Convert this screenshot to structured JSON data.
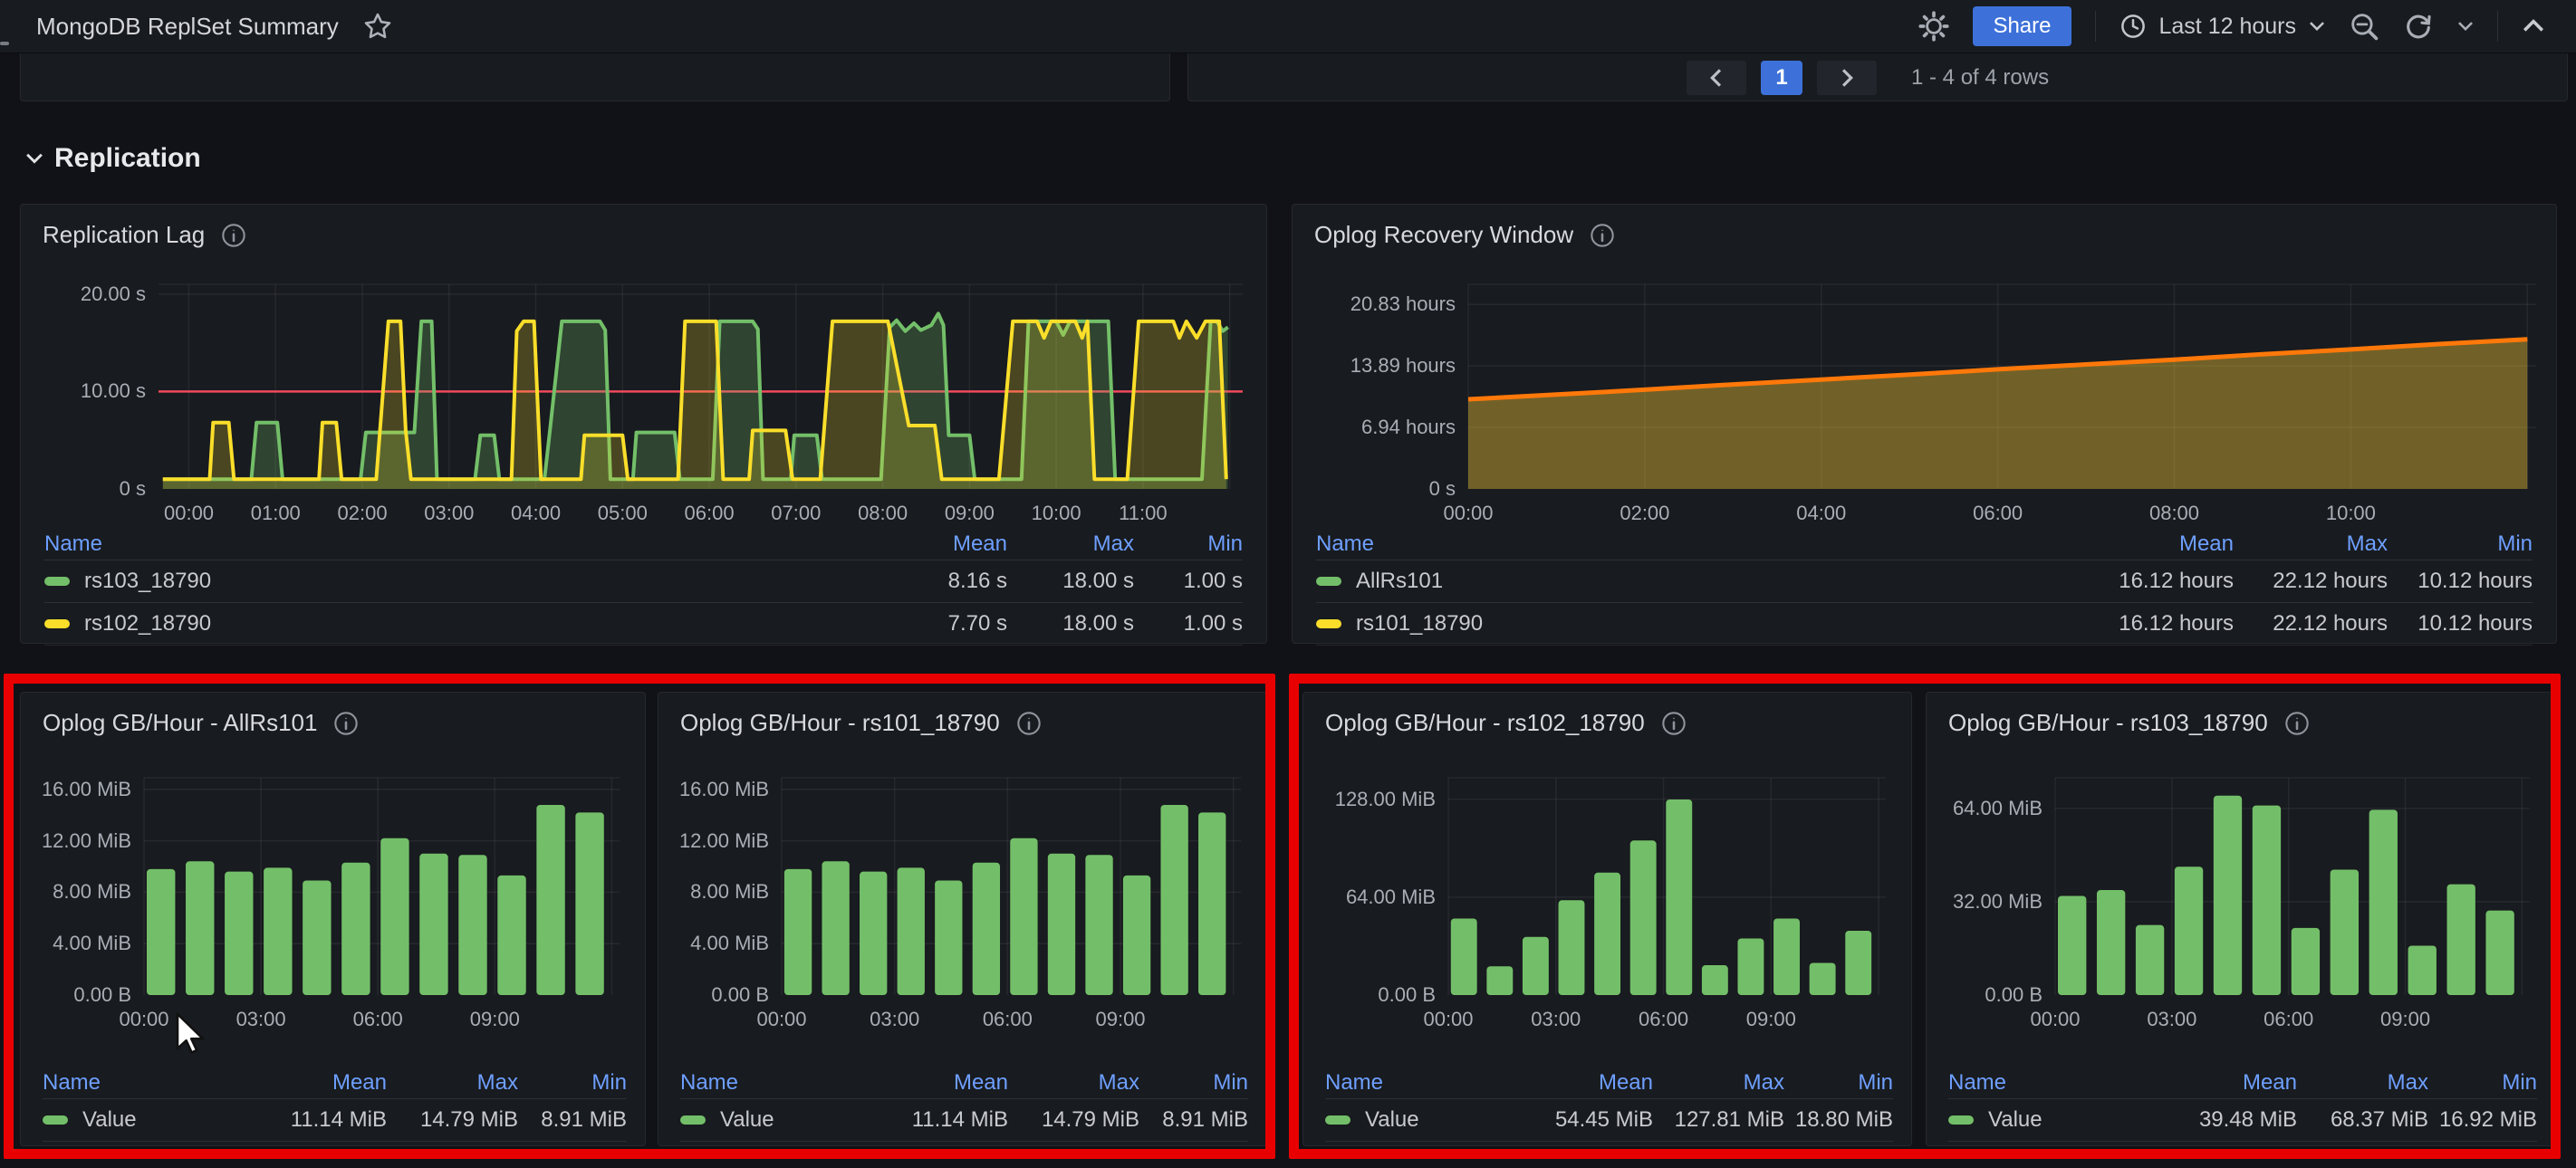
{
  "topbar": {
    "title": "MongoDB ReplSet Summary",
    "share_label": "Share",
    "time_range": "Last 12 hours"
  },
  "pagination": {
    "page": "1",
    "info": "1 - 4 of 4 rows"
  },
  "section": {
    "title": "Replication"
  },
  "colors": {
    "green": "#73BF69",
    "yellow": "#FADE2A",
    "orange": "#FF780A",
    "threshold_red": "#F2495C",
    "accent_blue": "#3D71D9",
    "legend_header_blue": "#6E9FFF",
    "annotation_red": "#E80000",
    "panel_bg": "#181b1f",
    "page_bg": "#111217"
  },
  "icons": {
    "star-icon": "outline star",
    "gear-icon": "settings gear",
    "clock-icon": "time range clock",
    "zoom-out-icon": "magnifier with minus",
    "refresh-icon": "circular arrow",
    "chevron-down-icon": "caret down",
    "chevron-up-icon": "collapse caret",
    "info-icon": "circled i"
  },
  "panels": {
    "replication_lag": {
      "title": "Replication Lag",
      "legend": {
        "headers": [
          "Name",
          "Mean",
          "Max",
          "Min"
        ],
        "rows": [
          {
            "name": "rs103_18790",
            "color": "#73BF69",
            "mean": "8.16 s",
            "max": "18.00 s",
            "min": "1.00 s"
          },
          {
            "name": "rs102_18790",
            "color": "#FADE2A",
            "mean": "7.70 s",
            "max": "18.00 s",
            "min": "1.00 s"
          }
        ]
      }
    },
    "oplog_recovery": {
      "title": "Oplog Recovery Window",
      "legend": {
        "headers": [
          "Name",
          "Mean",
          "Max",
          "Min"
        ],
        "rows": [
          {
            "name": "AllRs101",
            "color": "#73BF69",
            "mean": "16.12 hours",
            "max": "22.12 hours",
            "min": "10.12 hours"
          },
          {
            "name": "rs101_18790",
            "color": "#FADE2A",
            "mean": "16.12 hours",
            "max": "22.12 hours",
            "min": "10.12 hours"
          }
        ]
      }
    },
    "oplog": [
      {
        "title": "Oplog GB/Hour - AllRs101",
        "legend": {
          "headers": [
            "Name",
            "Mean",
            "Max",
            "Min"
          ],
          "row": {
            "name": "Value",
            "color": "#73BF69",
            "mean": "11.14 MiB",
            "max": "14.79 MiB",
            "min": "8.91 MiB"
          }
        }
      },
      {
        "title": "Oplog GB/Hour - rs101_18790",
        "legend": {
          "headers": [
            "Name",
            "Mean",
            "Max",
            "Min"
          ],
          "row": {
            "name": "Value",
            "color": "#73BF69",
            "mean": "11.14 MiB",
            "max": "14.79 MiB",
            "min": "8.91 MiB"
          }
        }
      },
      {
        "title": "Oplog GB/Hour - rs102_18790",
        "legend": {
          "headers": [
            "Name",
            "Mean",
            "Max",
            "Min"
          ],
          "row": {
            "name": "Value",
            "color": "#73BF69",
            "mean": "54.45 MiB",
            "max": "127.81 MiB",
            "min": "18.80 MiB"
          }
        }
      },
      {
        "title": "Oplog GB/Hour - rs103_18790",
        "legend": {
          "headers": [
            "Name",
            "Mean",
            "Max",
            "Min"
          ],
          "row": {
            "name": "Value",
            "color": "#73BF69",
            "mean": "39.48 MiB",
            "max": "68.37 MiB",
            "min": "16.92 MiB"
          }
        }
      }
    ]
  },
  "chart_data": [
    {
      "id": "replag",
      "type": "line",
      "title": "Replication Lag",
      "xlim": [
        -0.35,
        12.15
      ],
      "ylim": [
        0,
        21
      ],
      "pad": {
        "l": 130,
        "r": 18,
        "t": 8,
        "b": 56
      },
      "x_ticks": [
        {
          "v": 0,
          "label": "00:00"
        },
        {
          "v": 1,
          "label": "01:00"
        },
        {
          "v": 2,
          "label": "02:00"
        },
        {
          "v": 3,
          "label": "03:00"
        },
        {
          "v": 4,
          "label": "04:00"
        },
        {
          "v": 5,
          "label": "05:00"
        },
        {
          "v": 6,
          "label": "06:00"
        },
        {
          "v": 7,
          "label": "07:00"
        },
        {
          "v": 8,
          "label": "08:00"
        },
        {
          "v": 9,
          "label": "09:00"
        },
        {
          "v": 10,
          "label": "10:00"
        },
        {
          "v": 11,
          "label": "11:00"
        },
        {
          "v": 12,
          "label": ""
        }
      ],
      "y_ticks": [
        {
          "v": 0,
          "label": "0 s"
        },
        {
          "v": 10,
          "label": "10.00 s"
        },
        {
          "v": 20,
          "label": "20.00 s"
        }
      ],
      "threshold": {
        "v": 10,
        "color": "#F2495C"
      },
      "series": [
        {
          "name": "rs103_18790",
          "color": "#73BF69",
          "fill": "rgba(115,191,105,0.25)",
          "width": 4,
          "points": [
            [
              -0.3,
              1
            ],
            [
              0.72,
              1
            ],
            [
              0.78,
              6.8
            ],
            [
              1.02,
              6.8
            ],
            [
              1.08,
              1
            ],
            [
              1.98,
              1
            ],
            [
              2.04,
              5.8
            ],
            [
              2.6,
              5.8
            ],
            [
              2.68,
              17.2
            ],
            [
              2.8,
              17.2
            ],
            [
              2.86,
              1
            ],
            [
              3.3,
              1
            ],
            [
              3.36,
              5.5
            ],
            [
              3.52,
              5.5
            ],
            [
              3.58,
              1
            ],
            [
              4.1,
              1
            ],
            [
              4.16,
              5.8
            ],
            [
              4.3,
              17.2
            ],
            [
              4.74,
              17.2
            ],
            [
              4.8,
              16.3
            ],
            [
              4.86,
              1
            ],
            [
              5.12,
              1
            ],
            [
              5.16,
              5.8
            ],
            [
              5.6,
              5.8
            ],
            [
              5.66,
              1
            ],
            [
              6.04,
              1
            ],
            [
              6.12,
              17.2
            ],
            [
              6.5,
              17.2
            ],
            [
              6.56,
              16.4
            ],
            [
              6.62,
              1
            ],
            [
              6.94,
              1
            ],
            [
              6.98,
              5.5
            ],
            [
              7.24,
              5.5
            ],
            [
              7.3,
              1
            ],
            [
              7.98,
              1
            ],
            [
              8.08,
              16.6
            ],
            [
              8.16,
              17.3
            ],
            [
              8.26,
              16.2
            ],
            [
              8.36,
              17.0
            ],
            [
              8.44,
              16.3
            ],
            [
              8.56,
              16.8
            ],
            [
              8.64,
              18.0
            ],
            [
              8.7,
              16.8
            ],
            [
              8.76,
              5.5
            ],
            [
              9.0,
              5.5
            ],
            [
              9.06,
              1
            ],
            [
              9.6,
              1
            ],
            [
              9.68,
              17.2
            ],
            [
              10.0,
              17.2
            ],
            [
              10.08,
              15.8
            ],
            [
              10.16,
              17.2
            ],
            [
              10.6,
              17.2
            ],
            [
              10.68,
              1
            ],
            [
              11.68,
              1
            ],
            [
              11.78,
              17.2
            ],
            [
              11.85,
              17.2
            ],
            [
              11.92,
              16.2
            ],
            [
              11.98,
              16.6
            ]
          ]
        },
        {
          "name": "rs102_18790",
          "color": "#FADE2A",
          "fill": "rgba(250,222,42,0.22)",
          "width": 4,
          "points": [
            [
              -0.3,
              1
            ],
            [
              0.24,
              1
            ],
            [
              0.28,
              6.8
            ],
            [
              0.46,
              6.8
            ],
            [
              0.52,
              1
            ],
            [
              1.5,
              1
            ],
            [
              1.54,
              6.8
            ],
            [
              1.7,
              6.8
            ],
            [
              1.76,
              1
            ],
            [
              2.16,
              1
            ],
            [
              2.3,
              17.2
            ],
            [
              2.44,
              17.2
            ],
            [
              2.5,
              6.0
            ],
            [
              2.56,
              1
            ],
            [
              3.72,
              1
            ],
            [
              3.78,
              16.2
            ],
            [
              3.86,
              17.2
            ],
            [
              3.98,
              17.2
            ],
            [
              4.06,
              1
            ],
            [
              4.52,
              1
            ],
            [
              4.56,
              5.5
            ],
            [
              5.0,
              5.5
            ],
            [
              5.06,
              1
            ],
            [
              5.64,
              1
            ],
            [
              5.72,
              17.2
            ],
            [
              6.08,
              17.2
            ],
            [
              6.16,
              1
            ],
            [
              6.46,
              1
            ],
            [
              6.5,
              6.0
            ],
            [
              6.88,
              6.0
            ],
            [
              6.96,
              1
            ],
            [
              7.28,
              1
            ],
            [
              7.42,
              17.2
            ],
            [
              8.06,
              17.2
            ],
            [
              8.3,
              6.5
            ],
            [
              8.6,
              6.5
            ],
            [
              8.68,
              1
            ],
            [
              9.34,
              1
            ],
            [
              9.5,
              17.2
            ],
            [
              9.78,
              17.2
            ],
            [
              9.86,
              15.5
            ],
            [
              9.94,
              17.2
            ],
            [
              10.22,
              17.2
            ],
            [
              10.3,
              15.5
            ],
            [
              10.36,
              17.2
            ],
            [
              10.44,
              1
            ],
            [
              10.82,
              1
            ],
            [
              10.95,
              17.2
            ],
            [
              11.35,
              17.2
            ],
            [
              11.42,
              15.5
            ],
            [
              11.5,
              17.2
            ],
            [
              11.62,
              15.5
            ],
            [
              11.72,
              17.2
            ],
            [
              11.88,
              17.2
            ],
            [
              11.96,
              1
            ]
          ]
        }
      ]
    },
    {
      "id": "recovery",
      "type": "line",
      "title": "Oplog Recovery Window",
      "xlim": [
        0,
        12.1
      ],
      "ylim": [
        0,
        23.1
      ],
      "pad": {
        "l": 172,
        "r": 14,
        "t": 8,
        "b": 56
      },
      "x_ticks": [
        {
          "v": 0,
          "label": "00:00"
        },
        {
          "v": 2,
          "label": "02:00"
        },
        {
          "v": 4,
          "label": "04:00"
        },
        {
          "v": 6,
          "label": "06:00"
        },
        {
          "v": 8,
          "label": "08:00"
        },
        {
          "v": 10,
          "label": "10:00"
        },
        {
          "v": 12,
          "label": ""
        }
      ],
      "y_ticks": [
        {
          "v": 0,
          "label": "0 s"
        },
        {
          "v": 6.94,
          "label": "6.94 hours"
        },
        {
          "v": 13.89,
          "label": "13.89 hours"
        },
        {
          "v": 20.83,
          "label": "20.83 hours"
        }
      ],
      "series": [
        {
          "name": "rs101_18790",
          "color": "#FF780A",
          "fill": "rgba(222,184,51,0.45)",
          "width": 5,
          "points": [
            [
              0,
              10.12
            ],
            [
              1,
              10.65
            ],
            [
              2,
              11.2
            ],
            [
              3,
              11.8
            ],
            [
              4,
              12.35
            ],
            [
              5,
              12.9
            ],
            [
              6,
              13.5
            ],
            [
              7,
              14.05
            ],
            [
              8,
              14.6
            ],
            [
              9,
              15.2
            ],
            [
              10,
              15.75
            ],
            [
              11,
              16.35
            ],
            [
              12,
              16.9
            ]
          ]
        }
      ]
    },
    {
      "id": "op0",
      "type": "bars",
      "title": "Oplog GB/Hour - AllRs101",
      "color": "#73BF69",
      "xlim": [
        0,
        12.2
      ],
      "ylim": [
        0,
        16.9
      ],
      "pad": {
        "l": 128,
        "r": 16,
        "t": 6,
        "b": 50
      },
      "x_ticks": [
        {
          "v": 0,
          "label": "00:00"
        },
        {
          "v": 3,
          "label": "03:00"
        },
        {
          "v": 6,
          "label": "06:00"
        },
        {
          "v": 9,
          "label": "09:00"
        },
        {
          "v": 12,
          "label": ""
        }
      ],
      "y_ticks": [
        {
          "v": 0,
          "label": "0.00 B"
        },
        {
          "v": 4,
          "label": "4.00 MiB"
        },
        {
          "v": 8,
          "label": "8.00 MiB"
        },
        {
          "v": 12,
          "label": "12.00 MiB"
        },
        {
          "v": 16,
          "label": "16.00 MiB"
        }
      ],
      "values": [
        9.8,
        10.4,
        9.6,
        9.9,
        8.91,
        10.3,
        12.2,
        11.0,
        10.9,
        9.3,
        14.79,
        14.2
      ]
    },
    {
      "id": "op1",
      "type": "bars",
      "title": "Oplog GB/Hour - rs101_18790",
      "color": "#73BF69",
      "xlim": [
        0,
        12.2
      ],
      "ylim": [
        0,
        16.9
      ],
      "pad": {
        "l": 128,
        "r": 16,
        "t": 6,
        "b": 50
      },
      "x_ticks": [
        {
          "v": 0,
          "label": "00:00"
        },
        {
          "v": 3,
          "label": "03:00"
        },
        {
          "v": 6,
          "label": "06:00"
        },
        {
          "v": 9,
          "label": "09:00"
        },
        {
          "v": 12,
          "label": ""
        }
      ],
      "y_ticks": [
        {
          "v": 0,
          "label": "0.00 B"
        },
        {
          "v": 4,
          "label": "4.00 MiB"
        },
        {
          "v": 8,
          "label": "8.00 MiB"
        },
        {
          "v": 12,
          "label": "12.00 MiB"
        },
        {
          "v": 16,
          "label": "16.00 MiB"
        }
      ],
      "values": [
        9.8,
        10.4,
        9.6,
        9.9,
        8.91,
        10.3,
        12.2,
        11.0,
        10.9,
        9.3,
        14.79,
        14.2
      ]
    },
    {
      "id": "op2",
      "type": "bars",
      "title": "Oplog GB/Hour - rs102_18790",
      "color": "#73BF69",
      "xlim": [
        0,
        12.2
      ],
      "ylim": [
        0,
        142
      ],
      "pad": {
        "l": 152,
        "r": 16,
        "t": 6,
        "b": 50
      },
      "x_ticks": [
        {
          "v": 0,
          "label": "00:00"
        },
        {
          "v": 3,
          "label": "03:00"
        },
        {
          "v": 6,
          "label": "06:00"
        },
        {
          "v": 9,
          "label": "09:00"
        },
        {
          "v": 12,
          "label": ""
        }
      ],
      "y_ticks": [
        {
          "v": 0,
          "label": "0.00 B"
        },
        {
          "v": 64,
          "label": "64.00 MiB"
        },
        {
          "v": 128,
          "label": "128.00 MiB"
        }
      ],
      "values": [
        50,
        18.8,
        38,
        62,
        80,
        101,
        127.81,
        19.5,
        37,
        50,
        21,
        42
      ]
    },
    {
      "id": "op3",
      "type": "bars",
      "title": "Oplog GB/Hour - rs103_18790",
      "color": "#73BF69",
      "xlim": [
        0,
        12.2
      ],
      "ylim": [
        0,
        74.5
      ],
      "pad": {
        "l": 134,
        "r": 16,
        "t": 6,
        "b": 50
      },
      "x_ticks": [
        {
          "v": 0,
          "label": "00:00"
        },
        {
          "v": 3,
          "label": "03:00"
        },
        {
          "v": 6,
          "label": "06:00"
        },
        {
          "v": 9,
          "label": "09:00"
        },
        {
          "v": 12,
          "label": ""
        }
      ],
      "y_ticks": [
        {
          "v": 0,
          "label": "0.00 B"
        },
        {
          "v": 32,
          "label": "32.00 MiB"
        },
        {
          "v": 64,
          "label": "64.00 MiB"
        }
      ],
      "values": [
        34,
        36,
        24,
        44,
        68.37,
        65,
        23,
        43,
        63.5,
        16.92,
        38,
        29
      ]
    }
  ]
}
